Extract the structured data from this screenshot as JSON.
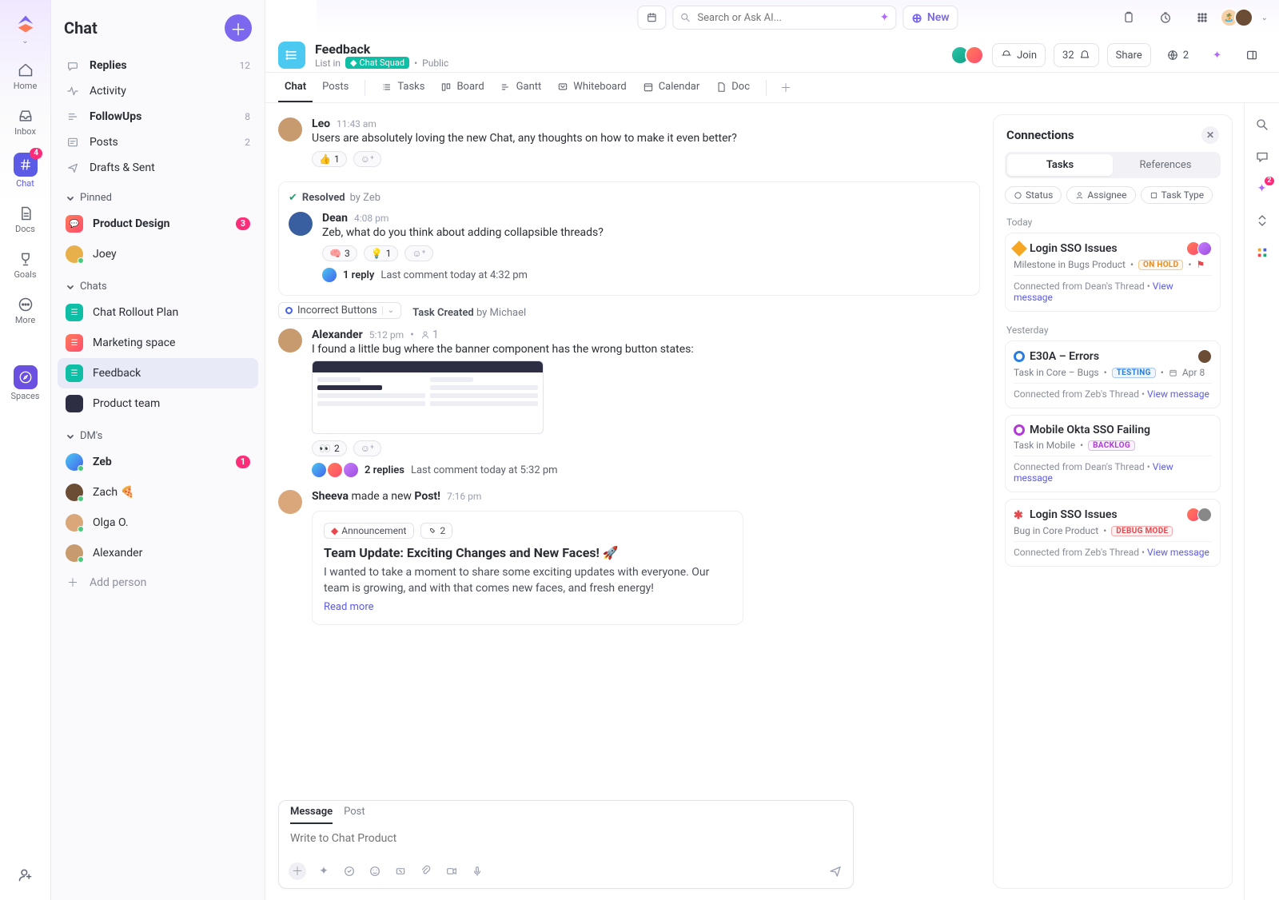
{
  "topbar": {
    "search_placeholder": "Search or Ask AI...",
    "new_label": "New"
  },
  "rail": {
    "items": [
      {
        "label": "Home",
        "icon": "home"
      },
      {
        "label": "Inbox",
        "icon": "inbox"
      },
      {
        "label": "Chat",
        "icon": "hash",
        "badge": "4",
        "active": true
      },
      {
        "label": "Docs",
        "icon": "doc"
      },
      {
        "label": "Goals",
        "icon": "trophy"
      },
      {
        "label": "More",
        "icon": "more"
      }
    ],
    "spaces_label": "Spaces"
  },
  "sidebar": {
    "title": "Chat",
    "top_items": [
      {
        "label": "Replies",
        "count": "12",
        "icon": "reply",
        "bold": true
      },
      {
        "label": "Activity",
        "icon": "activity"
      },
      {
        "label": "FollowUps",
        "count": "8",
        "icon": "followup",
        "bold": true
      },
      {
        "label": "Posts",
        "count": "2",
        "icon": "posts"
      },
      {
        "label": "Drafts & Sent",
        "icon": "drafts"
      }
    ],
    "pinned_label": "Pinned",
    "pinned": [
      {
        "label": "Product Design",
        "badge": "3"
      },
      {
        "label": "Joey"
      }
    ],
    "chats_label": "Chats",
    "chats": [
      {
        "label": "Chat Rollout Plan"
      },
      {
        "label": "Marketing space"
      },
      {
        "label": "Feedback",
        "active": true
      },
      {
        "label": "Product team"
      }
    ],
    "dms_label": "DM's",
    "dms": [
      {
        "label": "Zeb",
        "badge": "1",
        "bold": true
      },
      {
        "label": "Zach",
        "emoji": "🍕"
      },
      {
        "label": "Olga O."
      },
      {
        "label": "Alexander"
      }
    ],
    "add_person": "Add person"
  },
  "header": {
    "title": "Feedback",
    "list_in": "List in",
    "squad": "Chat Squad",
    "visibility": "Public",
    "join": "Join",
    "count": "32",
    "share": "Share",
    "guests": "2"
  },
  "views": [
    {
      "label": "Chat",
      "active": true
    },
    {
      "label": "Posts"
    },
    {
      "label": "Tasks",
      "icon": "list"
    },
    {
      "label": "Board",
      "icon": "board"
    },
    {
      "label": "Gantt",
      "icon": "gantt"
    },
    {
      "label": "Whiteboard",
      "icon": "whiteboard"
    },
    {
      "label": "Calendar",
      "icon": "calendar"
    },
    {
      "label": "Doc",
      "icon": "doc"
    }
  ],
  "messages": [
    {
      "author": "Leo",
      "time": "11:43 am",
      "text": "Users are absolutely loving the new Chat, any thoughts on how to make it even better?",
      "reactions": [
        {
          "emoji": "👍",
          "count": "1"
        }
      ]
    },
    {
      "resolved_by": "Zeb",
      "author": "Dean",
      "time": "4:08 pm",
      "text": "Zeb, what do you think about adding collapsible threads?",
      "reactions": [
        {
          "emoji": "🧠",
          "count": "3"
        },
        {
          "emoji": "💡",
          "count": "1"
        }
      ],
      "thread": {
        "replies": "1 reply",
        "meta": "Last comment today at 4:32 pm"
      }
    },
    {
      "task_chip": "Incorrect Buttons",
      "task_meta_label": "Task Created",
      "task_meta_by": "by Michael",
      "author": "Alexander",
      "time": "5:12 pm",
      "assigned": "1",
      "text": "I found a little bug where the banner component has the wrong button states:",
      "has_image": true,
      "reactions": [
        {
          "emoji": "👀",
          "count": "2"
        }
      ],
      "thread": {
        "replies": "2 replies",
        "meta": "Last comment today at 5:32 pm",
        "avatars": 3
      }
    }
  ],
  "post": {
    "author": "Sheeva",
    "verb": "made a new",
    "noun": "Post!",
    "time": "7:16 pm",
    "tag": "Announcement",
    "relation_count": "2",
    "title": "Team Update: Exciting Changes and New Faces! 🚀",
    "body": "I wanted to take a moment to share some exciting updates with everyone. Our team is growing, and with that comes new faces, and fresh energy!",
    "read_more": "Read more"
  },
  "composer": {
    "tabs": [
      "Message",
      "Post"
    ],
    "placeholder": "Write to Chat Product"
  },
  "connections": {
    "title": "Connections",
    "tabs": [
      "Tasks",
      "References"
    ],
    "filters": [
      "Status",
      "Assignee",
      "Task Type"
    ],
    "groups": [
      {
        "day": "Today",
        "cards": [
          {
            "icon": "diamond",
            "title": "Login SSO Issues",
            "sub": "Milestone in Bugs Product",
            "status": "ON HOLD",
            "status_cls": "onhold",
            "flag": true,
            "avatars": 2,
            "from": "Connected from Dean's Thread",
            "link": "View message"
          }
        ]
      },
      {
        "day": "Yesterday",
        "cards": [
          {
            "icon": "ring-blue",
            "title": "E30A – Errors",
            "sub": "Task in Core – Bugs",
            "status": "TESTING",
            "status_cls": "testing",
            "date": "Apr 8",
            "avatars": 1,
            "from": "Connected from Zeb's Thread",
            "link": "View message"
          },
          {
            "icon": "ring-purple",
            "title": "Mobile Okta SSO Failing",
            "sub": "Task in Mobile",
            "status": "BACKLOG",
            "status_cls": "backlog",
            "from": "Connected from Dean's Thread",
            "link": "View message"
          },
          {
            "icon": "bug",
            "title": "Login SSO Issues",
            "sub": "Bug in Core Product",
            "status": "DEBUG MODE",
            "status_cls": "debug",
            "avatars": 2,
            "from": "Connected from Zeb's Thread",
            "link": "View message"
          }
        ]
      }
    ]
  },
  "rrail_badge": "2"
}
